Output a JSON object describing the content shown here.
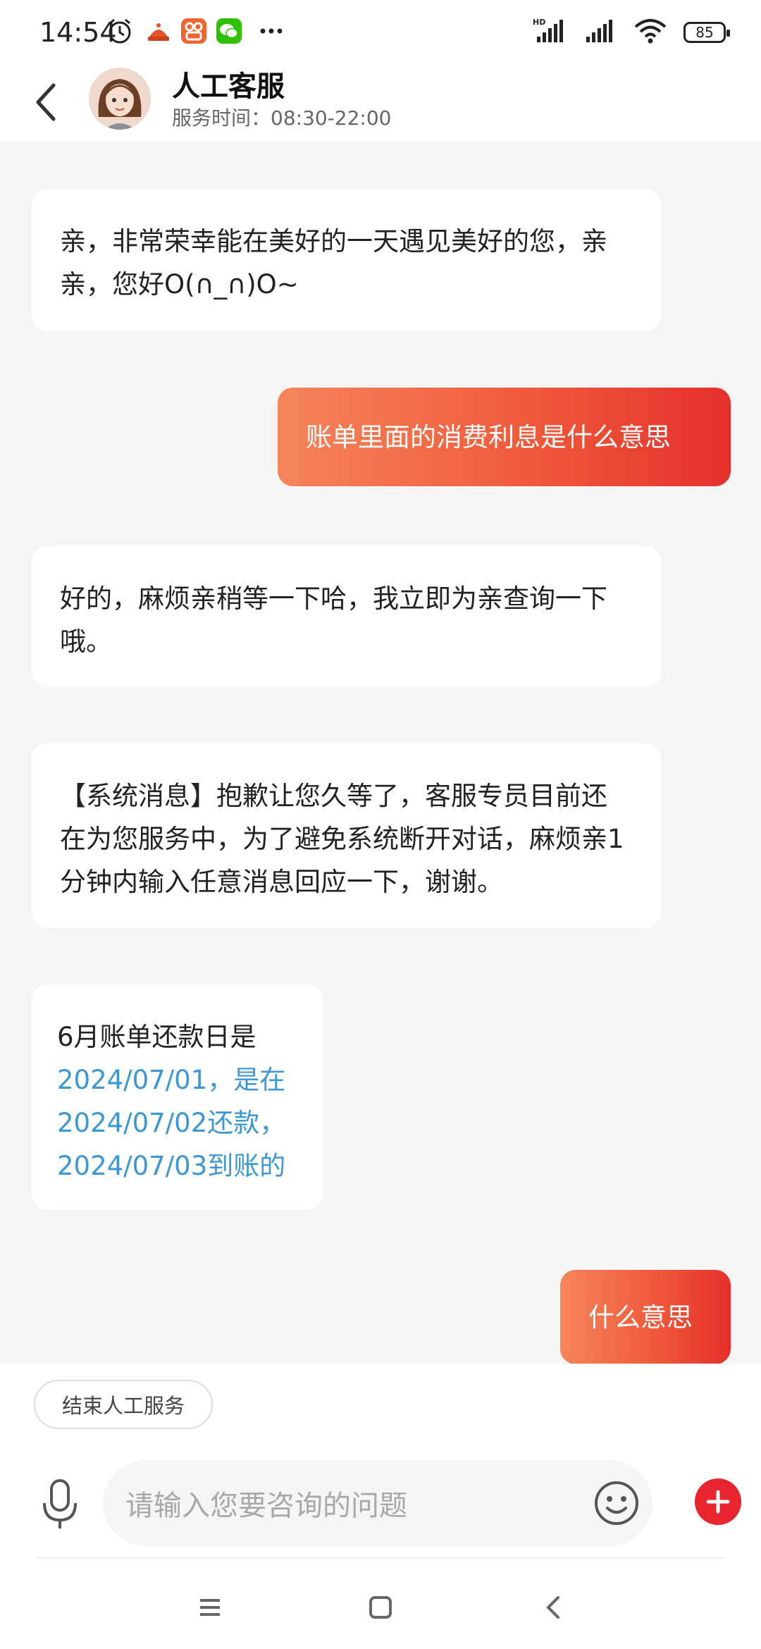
{
  "status_bar": {
    "time": "14:54",
    "battery": "85",
    "icons": [
      "alarm-icon",
      "app-icon-orange",
      "app-icon-kuaishou",
      "wechat-icon",
      "more-dots-icon",
      "hd-signal-icon",
      "signal-icon",
      "wifi-icon",
      "battery-icon"
    ]
  },
  "header": {
    "title": "人工客服",
    "subtitle": "服务时间：08:30-22:00"
  },
  "messages": [
    {
      "side": "left",
      "text": "亲，非常荣幸能在美好的一天遇见美好的您，亲亲，您好O(∩_∩)O~"
    },
    {
      "side": "right",
      "text": "账单里面的消费利息是什么意思"
    },
    {
      "side": "left",
      "text": "好的，麻烦亲稍等一下哈，我立即为亲查询一下哦。"
    },
    {
      "side": "left",
      "text": "【系统消息】抱歉让您久等了，客服专员目前还在为您服务中，为了避免系统断开对话，麻烦亲1分钟内输入任意消息回应一下，谢谢。"
    },
    {
      "side": "left",
      "text_plain": "6月账单还款日是",
      "text_link": "2024/07/01，是在2024/07/02还款，2024/07/03到账的"
    },
    {
      "side": "right",
      "text": "什么意思"
    }
  ],
  "bottom": {
    "end_service_label": "结束人工服务",
    "input_placeholder": "请输入您要咨询的问题"
  },
  "colors": {
    "accent": "#e52f2c",
    "accent_start": "#f5855a",
    "link": "#3b97d6",
    "background": "#f5f5f5"
  }
}
